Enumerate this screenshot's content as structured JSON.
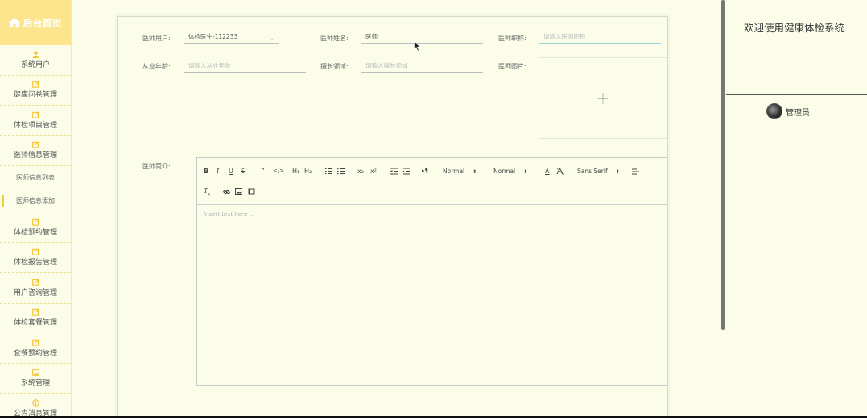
{
  "brand": {
    "title": "后台首页",
    "icon": "home-icon"
  },
  "menu": [
    {
      "label": "系统用户",
      "icon": "user-icon"
    },
    {
      "label": "健康问卷管理",
      "icon": "edit-icon"
    },
    {
      "label": "体检项目管理",
      "icon": "edit-icon"
    },
    {
      "label": "医师信息管理",
      "icon": "edit-icon"
    },
    {
      "label": "体检预约管理",
      "icon": "edit-icon"
    },
    {
      "label": "体检报告管理",
      "icon": "edit-icon"
    },
    {
      "label": "用户咨询管理",
      "icon": "edit-icon"
    },
    {
      "label": "体检套餐管理",
      "icon": "edit-icon"
    },
    {
      "label": "套餐预约管理",
      "icon": "edit-icon"
    },
    {
      "label": "系统管理",
      "icon": "image-icon"
    },
    {
      "label": "公告消息管理",
      "icon": "info-icon"
    }
  ],
  "submenu": [
    {
      "label": "医师信息列表",
      "active": false
    },
    {
      "label": "医师信息添加",
      "active": true
    }
  ],
  "form": {
    "doctor_user": {
      "label": "医师用户:",
      "value": "体检医生-112233"
    },
    "doctor_name": {
      "label": "医师姓名:",
      "value": "医师"
    },
    "doctor_title": {
      "label": "医师职称:",
      "placeholder": "请输入医师职称"
    },
    "years": {
      "label": "从业年龄:",
      "placeholder": "请输入从业年龄"
    },
    "specialty": {
      "label": "擅长领域:",
      "placeholder": "请输入擅长领域"
    },
    "photo": {
      "label": "医师图片:"
    },
    "intro": {
      "label": "医师简介:",
      "placeholder": "Insert text here ..."
    }
  },
  "editor_toolbar": {
    "bold": "B",
    "italic": "I",
    "underline": "U",
    "strike": "S",
    "blockquote": "❞",
    "code": "</>",
    "h1": "H₁",
    "h2": "H₂",
    "sub": "x₂",
    "sup": "x²",
    "size_select": "Normal",
    "header_select": "Normal",
    "font_select": "Sans Serif"
  },
  "header": {
    "welcome": "欢迎使用健康体检系统",
    "username": "管理员"
  }
}
